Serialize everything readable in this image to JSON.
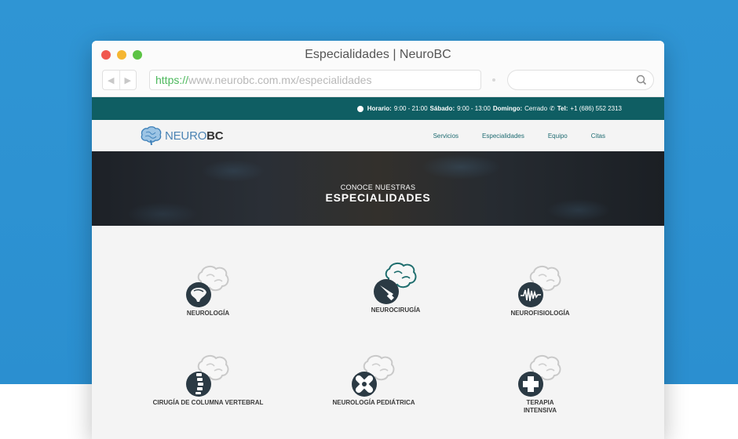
{
  "window": {
    "title": "Especialidades | NeuroBC",
    "url_scheme": "https://",
    "url_rest": "www.neurobc.com.mx/especialidades"
  },
  "topbar": {
    "horario_label": "Horario:",
    "horario_value": "9:00 - 21:00",
    "sabado_label": "Sábado:",
    "sabado_value": "9:00 - 13:00",
    "domingo_label": "Domingo:",
    "domingo_value": "Cerrado",
    "tel_label": "Tel:",
    "tel_value": "+1 (686) 552 2313"
  },
  "brand": {
    "thin": "NEURO",
    "bold": "BC"
  },
  "nav": {
    "items": [
      "Servicios",
      "Especialidades",
      "Equipo",
      "Citas"
    ]
  },
  "hero": {
    "subtitle": "CONOCE NUESTRAS",
    "title": "ESPECIALIDADES"
  },
  "specialties": [
    {
      "label": "NEUROLOGÍA",
      "icon": "brain-icon"
    },
    {
      "label": "NEUROCIRUGÍA",
      "icon": "scalpel-icon"
    },
    {
      "label": "NEUROFISIOLOGÍA",
      "icon": "pulse-wave-icon"
    },
    {
      "label": "CIRUGÍA DE COLUMNA VERTEBRAL",
      "icon": "spine-icon"
    },
    {
      "label": "NEUROLOGÍA PEDIÁTRICA",
      "icon": "bandage-icon"
    },
    {
      "label": "TERAPIA INTENSIVA",
      "icon": "medical-cross-icon"
    }
  ],
  "colors": {
    "teal": "#0f5e63",
    "icon_dark": "#2b3a44",
    "background_blue": "#2b8fd0"
  }
}
